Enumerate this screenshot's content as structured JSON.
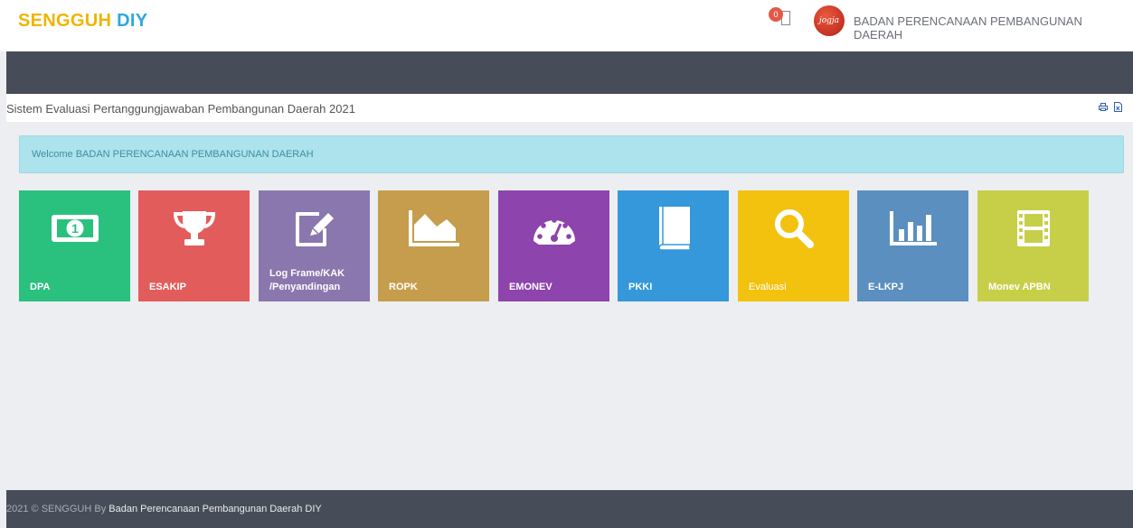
{
  "header": {
    "brand_part1": "SENGGUH",
    "brand_part2": "DIY",
    "notification_count": "0",
    "avatar_text": "jogja",
    "user_name": "BADAN PERENCANAAN PEMBANGUNAN DAERAH"
  },
  "page": {
    "title": "Sistem Evaluasi Pertanggungjawaban Pembangunan Daerah 2021",
    "welcome": "Welcome BADAN PERENCANAAN PEMBANGUNAN DAERAH"
  },
  "tiles": [
    {
      "label": "DPA",
      "icon": "money-icon",
      "color": "#2ac07e"
    },
    {
      "label": "ESAKIP",
      "icon": "trophy-icon",
      "color": "#e35c5c"
    },
    {
      "label_line1": "Log Frame/KAK",
      "label_line2": "/Penyandingan",
      "icon": "edit-icon",
      "color": "#8a77ae"
    },
    {
      "label": "ROPK",
      "icon": "area-chart-icon",
      "color": "#c69d4c"
    },
    {
      "label": "EMONEV",
      "icon": "dashboard-icon",
      "color": "#8d44ad"
    },
    {
      "label": "PKKI",
      "icon": "book-icon",
      "color": "#3498db"
    },
    {
      "label": "Evaluasi",
      "icon": "search-icon",
      "color": "#f2c20f"
    },
    {
      "label": "E-LKPJ",
      "icon": "bar-chart-icon",
      "color": "#5b8fc0"
    },
    {
      "label": "Monev APBN",
      "icon": "film-icon",
      "color": "#c7cf48"
    }
  ],
  "footer": {
    "prefix": "2021 © SENGGUH By ",
    "link": "Badan Perencanaan Pembangunan Daerah DIY"
  }
}
